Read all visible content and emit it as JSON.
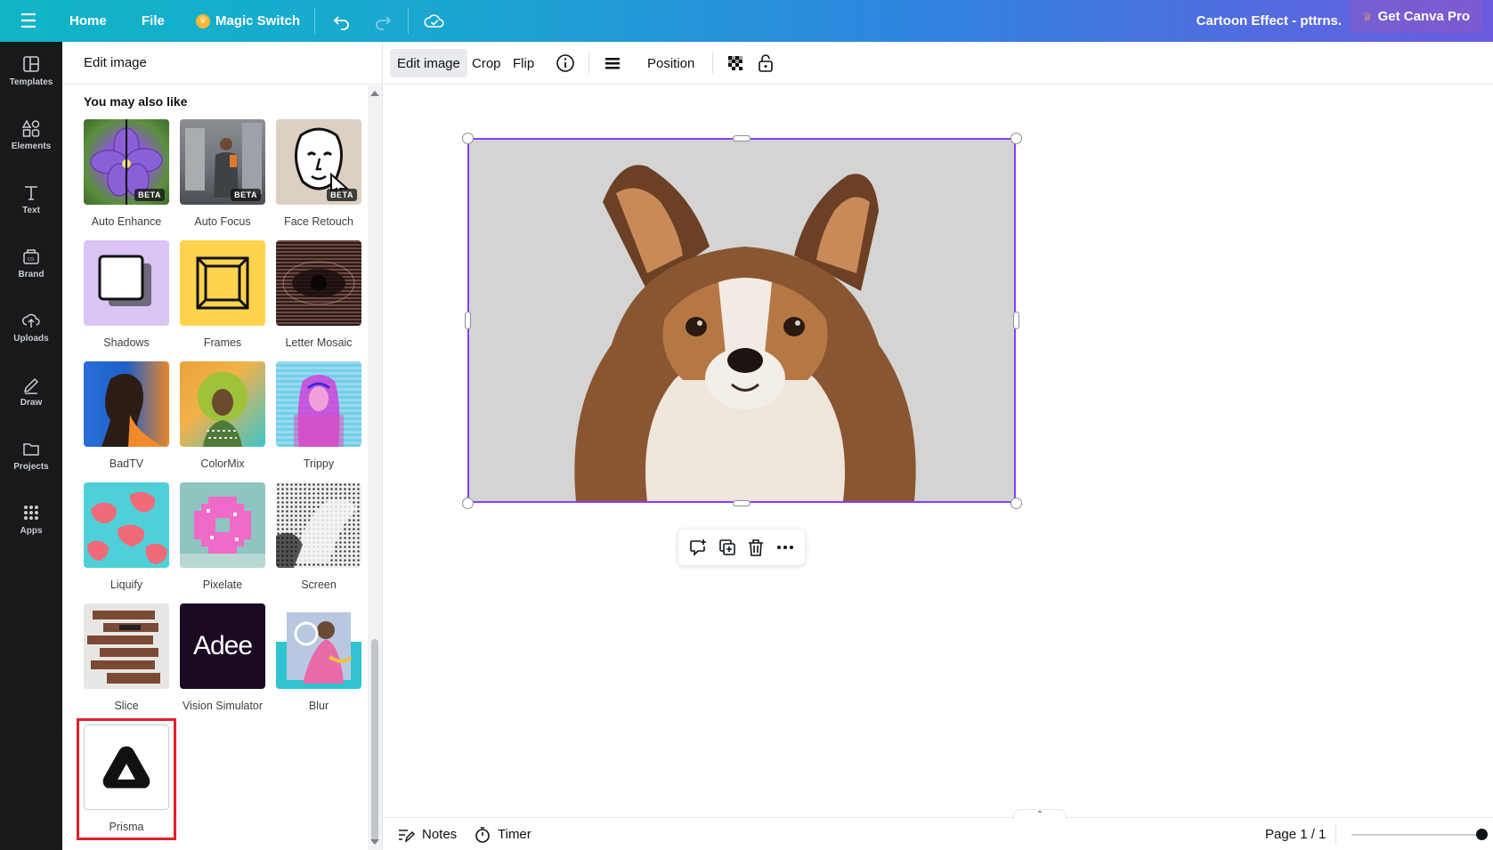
{
  "topbar": {
    "home": "Home",
    "file": "File",
    "magic_switch": "Magic Switch",
    "title": "Cartoon Effect - pttrns.",
    "get_pro": "Get Canva Pro"
  },
  "rail": {
    "items": [
      {
        "label": "Templates",
        "icon": "templates-icon"
      },
      {
        "label": "Elements",
        "icon": "elements-icon"
      },
      {
        "label": "Text",
        "icon": "text-icon"
      },
      {
        "label": "Brand",
        "icon": "brand-icon"
      },
      {
        "label": "Uploads",
        "icon": "uploads-icon"
      },
      {
        "label": "Draw",
        "icon": "draw-icon"
      },
      {
        "label": "Projects",
        "icon": "projects-icon"
      },
      {
        "label": "Apps",
        "icon": "apps-icon"
      }
    ]
  },
  "panel": {
    "title": "Edit image",
    "section_title": "You may also like",
    "beta_label": "BETA",
    "tiles": [
      {
        "label": "Auto Enhance",
        "beta": true
      },
      {
        "label": "Auto Focus",
        "beta": true
      },
      {
        "label": "Face Retouch",
        "beta": true
      },
      {
        "label": "Shadows"
      },
      {
        "label": "Frames"
      },
      {
        "label": "Letter Mosaic"
      },
      {
        "label": "BadTV"
      },
      {
        "label": "ColorMix"
      },
      {
        "label": "Trippy"
      },
      {
        "label": "Liquify"
      },
      {
        "label": "Pixelate"
      },
      {
        "label": "Screen"
      },
      {
        "label": "Slice"
      },
      {
        "label": "Vision Simulator",
        "logo_text": "Adee"
      },
      {
        "label": "Blur"
      },
      {
        "label": "Prisma",
        "highlighted": true
      }
    ]
  },
  "ctxbar": {
    "edit_image": "Edit image",
    "crop": "Crop",
    "flip": "Flip",
    "position": "Position"
  },
  "bottombar": {
    "notes": "Notes",
    "timer": "Timer",
    "page": "Page 1 / 1"
  },
  "colors": {
    "selection": "#8b3dff",
    "highlight": "#e0202a",
    "rail_bg": "#18191b"
  }
}
